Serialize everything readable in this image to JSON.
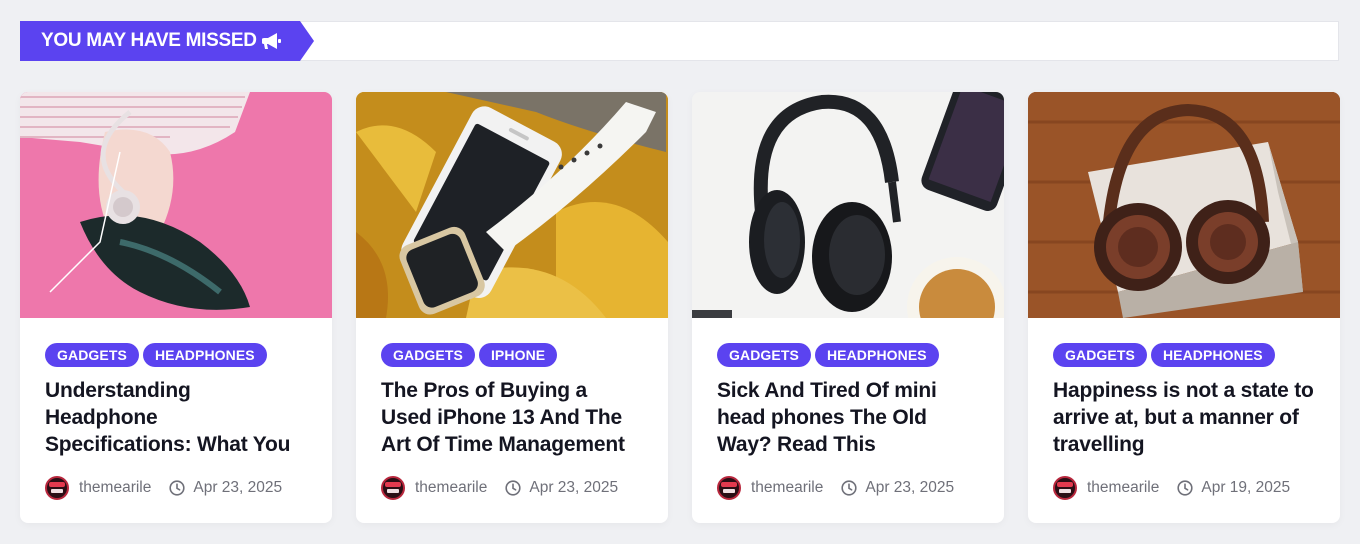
{
  "section": {
    "title": "YOU MAY HAVE MISSED",
    "icon": "megaphone-icon",
    "accent_color": "#5b43f0"
  },
  "cards": [
    {
      "image": "woman-with-headphones-on-pink-background",
      "tags": [
        "GADGETS",
        "HEADPHONES"
      ],
      "title": "Understanding Headphone Specifications: What You Need to",
      "author": "themearile",
      "date": "Apr 23, 2025"
    },
    {
      "image": "iphone-and-smartwatch-on-yellow-leaves",
      "tags": [
        "GADGETS",
        "IPHONE"
      ],
      "title": "The Pros of Buying a Used iPhone 13 And The Art Of Time Management",
      "author": "themearile",
      "date": "Apr 23, 2025"
    },
    {
      "image": "black-headphones-on-white-desk",
      "tags": [
        "GADGETS",
        "HEADPHONES"
      ],
      "title": "Sick And Tired Of mini head phones The Old Way? Read This",
      "author": "themearile",
      "date": "Apr 23, 2025"
    },
    {
      "image": "bronze-headphones-on-wooden-table",
      "tags": [
        "GADGETS",
        "HEADPHONES"
      ],
      "title": "Happiness is not a state to arrive at, but a manner of travelling",
      "author": "themearile",
      "date": "Apr 19, 2025"
    }
  ]
}
